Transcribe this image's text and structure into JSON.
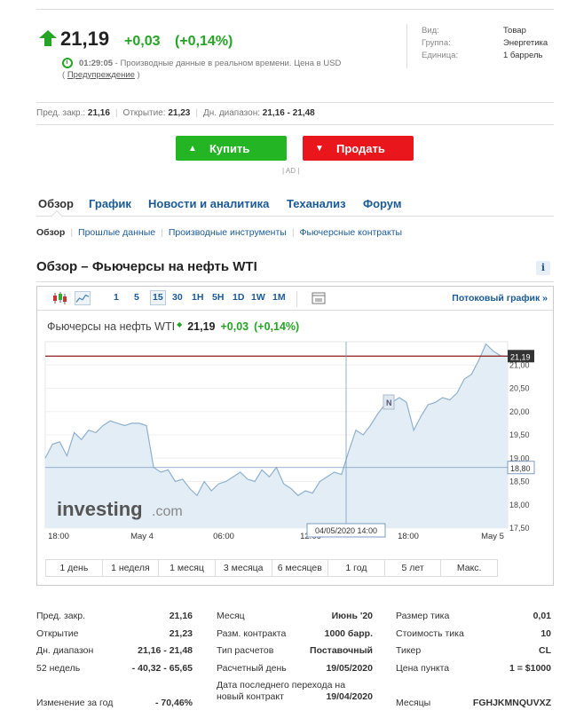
{
  "quote": {
    "price": "21,19",
    "change": "+0,03",
    "change_pct": "(+0,14%)",
    "time": "01:29:05",
    "status_text": " - Производные данные в реальном времени. Цена в ",
    "currency": "USD",
    "warning_open": "( ",
    "warning_link": "Предупреждение",
    "warning_close": " )",
    "up_color": "#24a524"
  },
  "meta": [
    {
      "label": "Вид:",
      "value": "Товар"
    },
    {
      "label": "Группа:",
      "value": "Энергетика"
    },
    {
      "label": "Единица:",
      "value": "1 баррель"
    }
  ],
  "stats_line": {
    "prev_close_label": "Пред. закр.:",
    "prev_close": "21,16",
    "open_label": "Открытие:",
    "open": "21,23",
    "day_range_label": "Дн. диапазон:",
    "day_range": "21,16 - 21,48"
  },
  "buttons": {
    "buy": "Купить",
    "sell": "Продать",
    "ad": "| AD |",
    "buy_color": "#24b524",
    "sell_color": "#e9161b"
  },
  "tabs": [
    "Обзор",
    "График",
    "Новости и аналитика",
    "Теханализ",
    "Форум"
  ],
  "subtabs": [
    "Обзор",
    "Прошлые данные",
    "Производные инструменты",
    "Фьючерсные контракты"
  ],
  "section_title": "Обзор – Фьючерсы на нефть WTI",
  "toolbar": {
    "timeframes": [
      "1",
      "5",
      "15",
      "30",
      "1H",
      "5H",
      "1D",
      "1W",
      "1M"
    ],
    "active_timeframe": "15",
    "stream_link": "Потоковый график »"
  },
  "chart_label": {
    "name": "Фьючерсы на нефть WTI",
    "price": "21,19",
    "change": "+0,03",
    "change_pct": "(+0,14%)"
  },
  "chart_data": {
    "type": "area",
    "x_labels": [
      "18:00",
      "May 4",
      "06:00",
      "12:00",
      "18:00",
      "May 5"
    ],
    "y_ticks": [
      "21,00",
      "20,50",
      "20,00",
      "19,50",
      "19,00",
      "18,50",
      "18,00",
      "17,50"
    ],
    "ylim": [
      17.5,
      21.5
    ],
    "current_price_label": "21,19",
    "current_price": 21.19,
    "crosshair_price_label": "18,80",
    "crosshair_price": 18.8,
    "crosshair_time": "04/05/2020 14:00",
    "news_marker": "N",
    "watermark": "investing",
    "watermark_suffix": ".com",
    "series": [
      {
        "values": [
          19.0,
          19.3,
          19.35,
          19.05,
          19.55,
          19.4,
          19.6,
          19.55,
          19.7,
          19.8,
          19.75,
          19.7,
          19.75,
          19.75,
          19.7,
          18.8,
          18.7,
          18.75,
          18.5,
          18.55,
          18.35,
          18.2,
          18.5,
          18.3,
          18.45,
          18.5,
          18.6,
          18.7,
          18.55,
          18.5,
          18.75,
          18.6,
          18.8,
          18.45,
          18.35,
          18.2,
          18.3,
          18.25,
          18.5,
          18.6,
          18.7,
          18.65,
          19.15,
          19.6,
          19.5,
          19.7,
          19.95,
          20.15,
          20.2,
          20.3,
          20.2,
          19.6,
          19.9,
          20.15,
          20.2,
          20.3,
          20.25,
          20.4,
          20.7,
          20.8,
          21.1,
          21.45,
          21.3,
          21.2,
          21.19
        ],
        "line_color": "#8fb1cf",
        "fill_color": "#e3edf5"
      }
    ],
    "price_line_color": "#8b1a1a"
  },
  "ranges": [
    "1 день",
    "1 неделя",
    "1 месяц",
    "3 месяца",
    "6 месяцев",
    "1 год",
    "5 лет",
    "Макс."
  ],
  "details": {
    "col1": [
      {
        "k": "Пред. закр.",
        "v": "21,16"
      },
      {
        "k": "Открытие",
        "v": "21,23"
      },
      {
        "k": "Дн. диапазон",
        "v": "21,16 - 21,48"
      },
      {
        "k": "52 недель",
        "v": "- 40,32 - 65,65"
      },
      {
        "k": "",
        "v": ""
      },
      {
        "k": "Изменение за год",
        "v": "- 70,46%"
      }
    ],
    "col2": [
      {
        "k": "Месяц",
        "v": "Июнь '20"
      },
      {
        "k": "Разм. контракта",
        "v": "1000 барр."
      },
      {
        "k": "Тип расчетов",
        "v": "Поставочный"
      },
      {
        "k": "Расчетный день",
        "v": "19/05/2020"
      },
      {
        "k": "Дата последнего перехода на",
        "v": ""
      },
      {
        "k": "новый контракт",
        "v": "19/04/2020"
      }
    ],
    "col3": [
      {
        "k": "Размер тика",
        "v": "0,01"
      },
      {
        "k": "Стоимость тика",
        "v": "10"
      },
      {
        "k": "Тикер",
        "v": "CL"
      },
      {
        "k": "Цена пункта",
        "v": "1 = $1000"
      },
      {
        "k": "",
        "v": ""
      },
      {
        "k": "Месяцы",
        "v": "FGHJKMNQUVXZ"
      }
    ]
  }
}
